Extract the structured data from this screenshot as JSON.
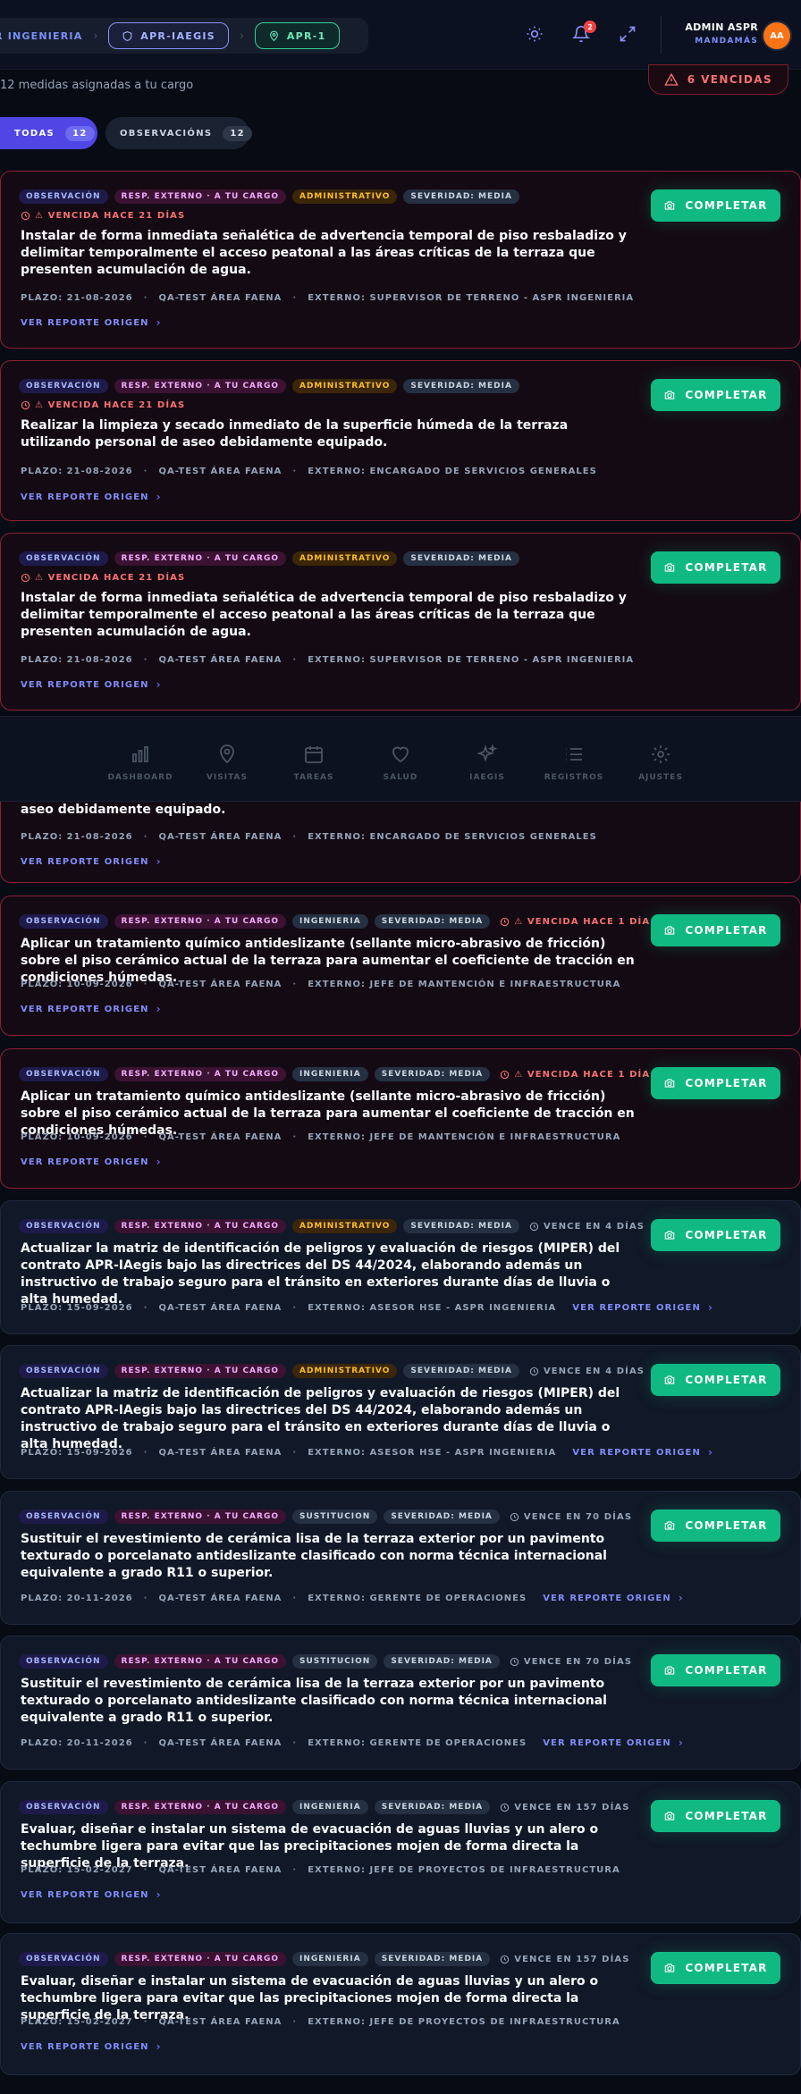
{
  "header": {
    "breadcrumb_first": "R INGENIERIA",
    "project_label": "APR-IAEGIS",
    "location_label": "APR-1",
    "notifications_count": "2",
    "user_name": "ADMIN ASPR",
    "user_role": "MANDAMÁS",
    "user_initials": "AA"
  },
  "summary": {
    "subtitle": "12 medidas asignadas a tu cargo",
    "overdue_label": "6 VENCIDAS"
  },
  "filters": [
    {
      "label": "TODAS",
      "count": "12",
      "active": true
    },
    {
      "label": "OBSERVACIÓNS",
      "count": "12",
      "active": false
    }
  ],
  "card_button_label": "COMPLETAR",
  "link_label": "VER REPORTE ORIGEN",
  "cards": [
    {
      "badges": [
        "OBSERVACIÓN",
        "RESP. EXTERNO · A TU CARGO",
        "ADMINISTRATIVO",
        "SEVERIDAD: MEDIA"
      ],
      "due": "⚠ VENCIDA HACE 21 DÍAS",
      "title": "Instalar de forma inmediata señalética de advertencia temporal de piso resbaladizo y delimitar temporalmente el acceso peatonal a las áreas críticas de la terraza que presenten acumulación de agua.",
      "plazo": "PLAZO: 21-08-2026",
      "area": "QA-TEST ÁREA FAENA",
      "externo": "EXTERNO: SUPERVISOR DE TERRENO - ASPR INGENIERIA"
    },
    {
      "badges": [
        "OBSERVACIÓN",
        "RESP. EXTERNO · A TU CARGO",
        "ADMINISTRATIVO",
        "SEVERIDAD: MEDIA"
      ],
      "due": "⚠ VENCIDA HACE 21 DÍAS",
      "title": "Realizar la limpieza y secado inmediato de la superficie húmeda de la terraza utilizando personal de aseo debidamente equipado.",
      "plazo": "PLAZO: 21-08-2026",
      "area": "QA-TEST ÁREA FAENA",
      "externo": "EXTERNO: ENCARGADO DE SERVICIOS GENERALES"
    },
    {
      "badges": [
        "OBSERVACIÓN",
        "RESP. EXTERNO · A TU CARGO",
        "ADMINISTRATIVO",
        "SEVERIDAD: MEDIA"
      ],
      "due": "⚠ VENCIDA HACE 21 DÍAS",
      "title": "Instalar de forma inmediata señalética de advertencia temporal de piso resbaladizo y delimitar temporalmente el acceso peatonal a las áreas críticas de la terraza que presenten acumulación de agua.",
      "plazo": "PLAZO: 21-08-2026",
      "area": "QA-TEST ÁREA FAENA",
      "externo": "EXTERNO: SUPERVISOR DE TERRENO - ASPR INGENIERIA"
    },
    {
      "title_tail": "aseo debidamente equipado.",
      "plazo": "PLAZO: 21-08-2026",
      "area": "QA-TEST ÁREA FAENA",
      "externo": "EXTERNO: ENCARGADO DE SERVICIOS GENERALES"
    },
    {
      "badges": [
        "OBSERVACIÓN",
        "RESP. EXTERNO · A TU CARGO",
        "INGENIERIA",
        "SEVERIDAD: MEDIA"
      ],
      "due": "⚠ VENCIDA HACE 1 DÍA",
      "title": "Aplicar un tratamiento químico antideslizante (sellante micro-abrasivo de fricción) sobre el piso cerámico actual de la terraza para aumentar el coeficiente de tracción en condiciones húmedas.",
      "plazo": "PLAZO: 10-09-2026",
      "area": "QA-TEST ÁREA FAENA",
      "externo": "EXTERNO: JEFE DE MANTENCIÓN E INFRAESTRUCTURA"
    },
    {
      "badges": [
        "OBSERVACIÓN",
        "RESP. EXTERNO · A TU CARGO",
        "INGENIERIA",
        "SEVERIDAD: MEDIA"
      ],
      "due": "⚠ VENCIDA HACE 1 DÍA",
      "title": "Aplicar un tratamiento químico antideslizante (sellante micro-abrasivo de fricción) sobre el piso cerámico actual de la terraza para aumentar el coeficiente de tracción en condiciones húmedas.",
      "plazo": "PLAZO: 10-09-2026",
      "area": "QA-TEST ÁREA FAENA",
      "externo": "EXTERNO: JEFE DE MANTENCIÓN E INFRAESTRUCTURA"
    },
    {
      "badges": [
        "OBSERVACIÓN",
        "RESP. EXTERNO · A TU CARGO",
        "ADMINISTRATIVO",
        "SEVERIDAD: MEDIA"
      ],
      "due": "VENCE EN 4 DÍAS",
      "title": "Actualizar la matriz de identificación de peligros y evaluación de riesgos (MIPER) del contrato APR-IAegis bajo las directrices del DS 44/2024, elaborando además un instructivo de trabajo seguro para el tránsito en exteriores durante días de lluvia o alta humedad.",
      "plazo": "PLAZO: 15-09-2026",
      "area": "QA-TEST ÁREA FAENA",
      "externo": "EXTERNO: ASESOR HSE - ASPR INGENIERIA"
    },
    {
      "badges": [
        "OBSERVACIÓN",
        "RESP. EXTERNO · A TU CARGO",
        "ADMINISTRATIVO",
        "SEVERIDAD: MEDIA"
      ],
      "due": "VENCE EN 4 DÍAS",
      "title": "Actualizar la matriz de identificación de peligros y evaluación de riesgos (MIPER) del contrato APR-IAegis bajo las directrices del DS 44/2024, elaborando además un instructivo de trabajo seguro para el tránsito en exteriores durante días de lluvia o alta humedad.",
      "plazo": "PLAZO: 15-09-2026",
      "area": "QA-TEST ÁREA FAENA",
      "externo": "EXTERNO: ASESOR HSE - ASPR INGENIERIA"
    },
    {
      "badges": [
        "OBSERVACIÓN",
        "RESP. EXTERNO · A TU CARGO",
        "SUSTITUCION",
        "SEVERIDAD: MEDIA"
      ],
      "due": "VENCE EN 70 DÍAS",
      "title": "Sustituir el revestimiento de cerámica lisa de la terraza exterior por un pavimento texturado o porcelanato antideslizante clasificado con norma técnica internacional equivalente a grado R11 o superior.",
      "plazo": "PLAZO: 20-11-2026",
      "area": "QA-TEST ÁREA FAENA",
      "externo": "EXTERNO: GERENTE DE OPERACIONES"
    },
    {
      "badges": [
        "OBSERVACIÓN",
        "RESP. EXTERNO · A TU CARGO",
        "SUSTITUCION",
        "SEVERIDAD: MEDIA"
      ],
      "due": "VENCE EN 70 DÍAS",
      "title": "Sustituir el revestimiento de cerámica lisa de la terraza exterior por un pavimento texturado o porcelanato antideslizante clasificado con norma técnica internacional equivalente a grado R11 o superior.",
      "plazo": "PLAZO: 20-11-2026",
      "area": "QA-TEST ÁREA FAENA",
      "externo": "EXTERNO: GERENTE DE OPERACIONES"
    },
    {
      "badges": [
        "OBSERVACIÓN",
        "RESP. EXTERNO · A TU CARGO",
        "INGENIERIA",
        "SEVERIDAD: MEDIA"
      ],
      "due": "VENCE EN 157 DÍAS",
      "title": "Evaluar, diseñar e instalar un sistema de evacuación de aguas lluvias y un alero o techumbre ligera para evitar que las precipitaciones mojen de forma directa la superficie de la terraza.",
      "plazo": "PLAZO: 15-02-2027",
      "area": "QA-TEST ÁREA FAENA",
      "externo": "EXTERNO: JEFE DE PROYECTOS DE INFRAESTRUCTURA"
    },
    {
      "badges": [
        "OBSERVACIÓN",
        "RESP. EXTERNO · A TU CARGO",
        "INGENIERIA",
        "SEVERIDAD: MEDIA"
      ],
      "due": "VENCE EN 157 DÍAS",
      "title": "Evaluar, diseñar e instalar un sistema de evacuación de aguas lluvias y un alero o techumbre ligera para evitar que las precipitaciones mojen de forma directa la superficie de la terraza.",
      "plazo": "PLAZO: 15-02-2027",
      "area": "QA-TEST ÁREA FAENA",
      "externo": "EXTERNO: JEFE DE PROYECTOS DE INFRAESTRUCTURA"
    }
  ],
  "bottom_nav": [
    {
      "label": "DASHBOARD",
      "icon": "bar-chart-icon"
    },
    {
      "label": "VISITAS",
      "icon": "map-pin-icon"
    },
    {
      "label": "TAREAS",
      "icon": "calendar-icon"
    },
    {
      "label": "SALUD",
      "icon": "heart-icon"
    },
    {
      "label": "IAEGIS",
      "icon": "sparkles-icon"
    },
    {
      "label": "REGISTROS",
      "icon": "list-icon"
    },
    {
      "label": "AJUSTES",
      "icon": "settings-icon"
    }
  ],
  "colors": {
    "accent": "#4f46e5",
    "success": "#10b981",
    "danger": "#f87171",
    "background": "#070b14"
  }
}
